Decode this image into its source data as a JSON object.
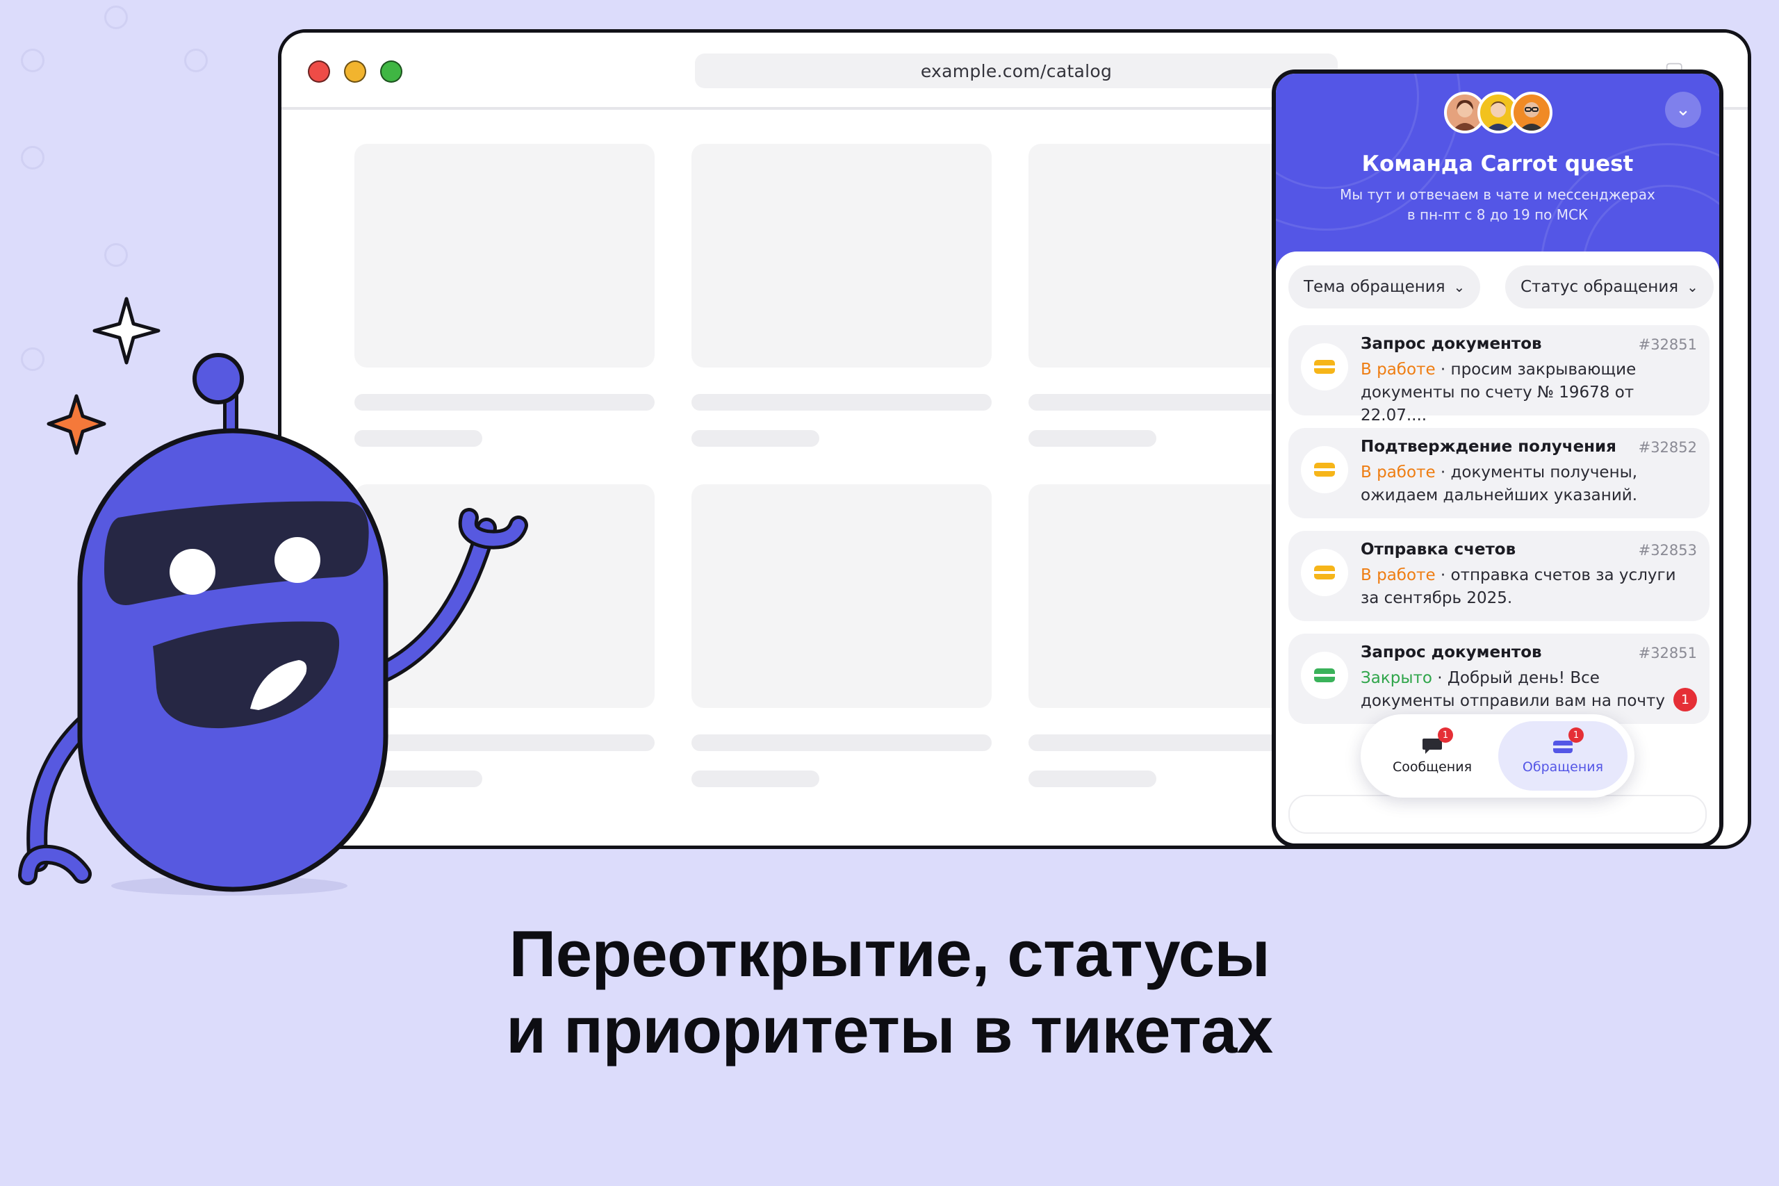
{
  "browser": {
    "url": "example.com/catalog",
    "traffic_colors": [
      "#ee4c47",
      "#f2b42e",
      "#3fb643"
    ]
  },
  "widget": {
    "title": "Команда Carrot quest",
    "subtitle_line1": "Мы тут и отвечаем в чате и мессенджерах",
    "subtitle_line2": "в пн-пт с 8 до 19 по МСК",
    "filters": {
      "topic": "Тема обращения",
      "status": "Статус обращения"
    },
    "tickets": [
      {
        "title": "Запрос документов",
        "number": "#32851",
        "status": "В работе",
        "text": " · просим закрывающие документы по счету № 19678 от 22.07...."
      },
      {
        "title": "Подтверждение получения",
        "number": "#32852",
        "status": "В работе",
        "text": " · документы получены, ожидаем дальнейших указаний."
      },
      {
        "title": "Отправка счетов",
        "number": "#32853",
        "status": "В работе",
        "text": " · отправка счетов за услуги за сентябрь 2025."
      },
      {
        "title": "Запрос документов",
        "number": "#32851",
        "status": "Закрыто",
        "text": " · Добрый день! Все документы отправили вам на почту",
        "unread": "1"
      }
    ],
    "nav": {
      "messages_label": "Сообщения",
      "messages_badge": "1",
      "tickets_label": "Обращения",
      "tickets_badge": "1"
    },
    "colors": {
      "accent": "#5456e6",
      "in_progress": "#ee7d12",
      "closed": "#2fa54a",
      "alert": "#e52f36",
      "in_progress_icon": "#f6b519",
      "closed_icon": "#3ab25a"
    }
  },
  "headline": {
    "line1": "Переоткрытие, статусы",
    "line2": "и приоритеты в тикетах"
  },
  "mascot": {
    "color": "#5759e0"
  }
}
